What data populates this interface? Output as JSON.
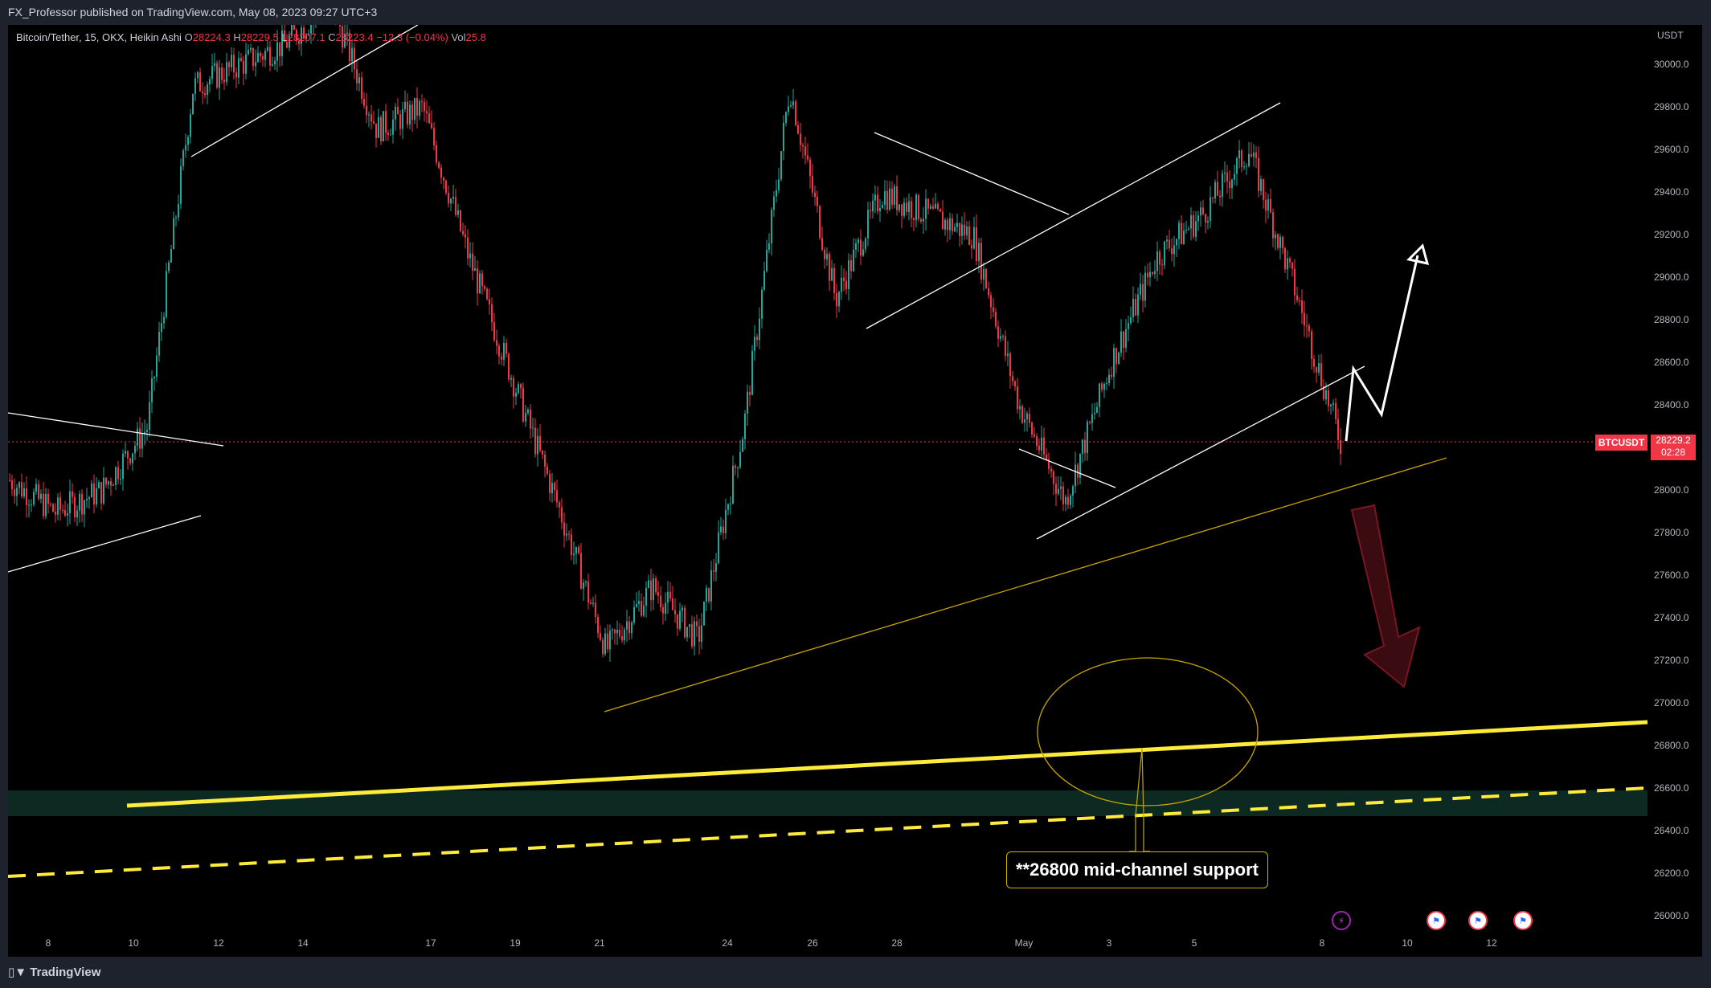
{
  "header": {
    "published": "FX_Professor published on TradingView.com, May 08, 2023 09:27 UTC+3"
  },
  "legend": {
    "symbol": "Bitcoin/Tether, 15, OKX, Heikin Ashi",
    "open_label": "O",
    "open": "28224.3",
    "high_label": "H",
    "high": "28229.5",
    "low_label": "L",
    "low": "28207.1",
    "close_label": "C",
    "close": "28223.4",
    "change": "−12.3 (−0.04%)",
    "vol_label": "Vol",
    "vol": "25.8"
  },
  "price_axis": {
    "currency": "USDT",
    "labels": [
      "30000.0",
      "29800.0",
      "29600.0",
      "29400.0",
      "29200.0",
      "29000.0",
      "28800.0",
      "28600.0",
      "28400.0",
      "28000.0",
      "27800.0",
      "27600.0",
      "27400.0",
      "27200.0",
      "27000.0",
      "26800.0",
      "26600.0",
      "26400.0",
      "26200.0",
      "26000.0"
    ]
  },
  "time_axis": {
    "labels": [
      "8",
      "10",
      "12",
      "14",
      "17",
      "19",
      "21",
      "24",
      "26",
      "28",
      "May",
      "3",
      "5",
      "8",
      "10",
      "12"
    ]
  },
  "last_price": {
    "ticker": "BTCUSDT",
    "price": "28229.2",
    "countdown": "02:28",
    "color": "#f23645"
  },
  "annotation": {
    "text": "**26800 mid-channel support"
  },
  "footer": {
    "brand": "TradingView"
  },
  "colors": {
    "background": "#000000",
    "up": "#26a69a",
    "down": "#f23645",
    "trendline": "#ffffff",
    "support": "#ffeb3b",
    "channel_zone": "#0d2a22"
  },
  "chart_data": {
    "type": "candlestick",
    "instrument": "Bitcoin/Tether",
    "interval": "15",
    "exchange": "OKX",
    "style": "Heikin Ashi",
    "y_unit": "USDT",
    "ylim": [
      25900,
      30150
    ],
    "x_period": "Apr 7 – May 12, 2023",
    "price_path_approx": [
      {
        "date": "Apr 7",
        "price": 28050
      },
      {
        "date": "Apr 8",
        "price": 27900
      },
      {
        "date": "Apr 9",
        "price": 28000
      },
      {
        "date": "Apr 10",
        "price": 28300
      },
      {
        "date": "Apr 11",
        "price": 29900
      },
      {
        "date": "Apr 12",
        "price": 30000
      },
      {
        "date": "Apr 13",
        "price": 30100
      },
      {
        "date": "Apr 16",
        "price": 30300
      },
      {
        "date": "Apr 17",
        "price": 29700
      },
      {
        "date": "Apr 18",
        "price": 29800
      },
      {
        "date": "Apr 19",
        "price": 29100
      },
      {
        "date": "Apr 20",
        "price": 28500
      },
      {
        "date": "Apr 21",
        "price": 27900
      },
      {
        "date": "Apr 22",
        "price": 27250
      },
      {
        "date": "Apr 24",
        "price": 27550
      },
      {
        "date": "Apr 25",
        "price": 27300
      },
      {
        "date": "Apr 26",
        "price": 28300
      },
      {
        "date": "Apr 26b",
        "price": 29900
      },
      {
        "date": "Apr 27",
        "price": 28900
      },
      {
        "date": "Apr 28",
        "price": 29400
      },
      {
        "date": "Apr 29",
        "price": 29300
      },
      {
        "date": "Apr 30",
        "price": 29200
      },
      {
        "date": "May 1",
        "price": 28400
      },
      {
        "date": "May 2",
        "price": 27950
      },
      {
        "date": "May 3",
        "price": 28600
      },
      {
        "date": "May 4",
        "price": 29100
      },
      {
        "date": "May 5",
        "price": 29300
      },
      {
        "date": "May 6",
        "price": 29600
      },
      {
        "date": "May 7",
        "price": 28950
      },
      {
        "date": "May 8",
        "price": 28230
      }
    ],
    "support_level": 26800,
    "projection": {
      "bullish_target_approx": 29100,
      "bearish_target_approx": 27100
    },
    "grid": false
  }
}
